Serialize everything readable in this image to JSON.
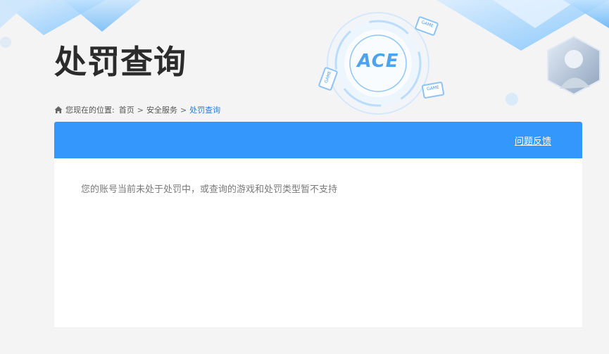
{
  "header": {
    "title": "处罚查询",
    "logo_text": "ACE",
    "game_badge_text": "GAME"
  },
  "breadcrumb": {
    "prefix": "您现在的位置:",
    "items": [
      "首页",
      "安全服务",
      "处罚查询"
    ],
    "separator": ">"
  },
  "panel": {
    "feedback_label": "问题反馈",
    "message": "您的账号当前未处于处罚中，或查询的游戏和处罚类型暂不支持"
  },
  "colors": {
    "accent": "#3497fb",
    "link_current": "#2b7bd6",
    "background": "#f4f4f5"
  }
}
